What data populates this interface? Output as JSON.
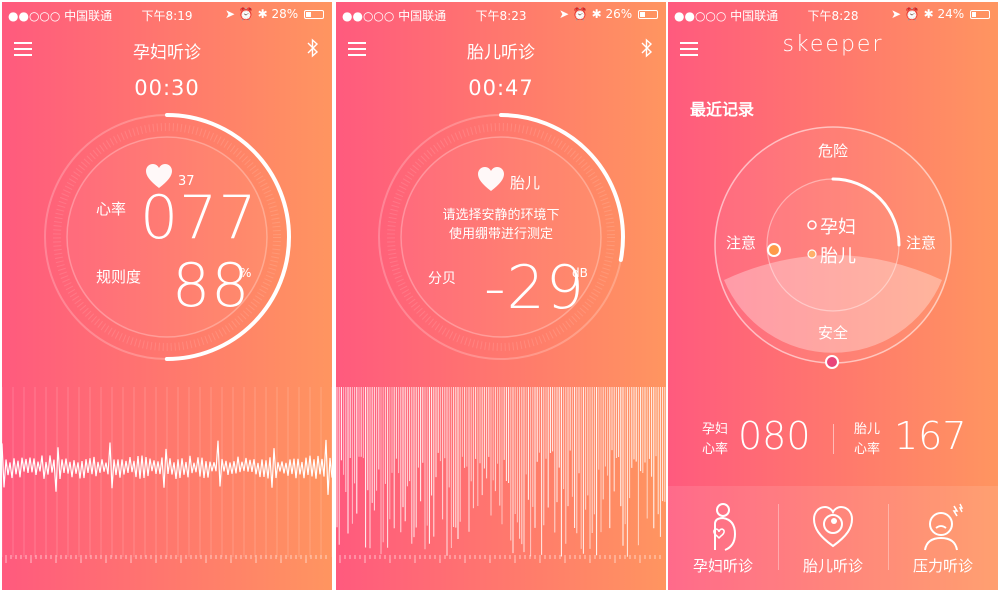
{
  "status_bars": [
    {
      "carrier": "●●○○○ 中国联通",
      "time": "下午8:19",
      "battery": "28%",
      "battery_level": 0.28
    },
    {
      "carrier": "●●○○○ 中国联通",
      "time": "下午8:23",
      "battery": "26%",
      "battery_level": 0.26
    },
    {
      "carrier": "●●○○○ 中国联通",
      "time": "下午8:28",
      "battery": "24%",
      "battery_level": 0.24
    }
  ],
  "maternal_screen": {
    "title": "孕妇听诊",
    "timer": "00:30",
    "heart_badge": "37",
    "heart_rate_label": "心率",
    "heart_rate_value": "077",
    "regularity_label": "规则度",
    "regularity_value": "88",
    "regularity_unit": "%",
    "progress": 0.5
  },
  "fetal_screen": {
    "title": "胎儿听诊",
    "timer": "00:47",
    "heart_label": "胎儿",
    "instruction_line1": "请选择安静的环境下",
    "instruction_line2": "使用绷带进行测定",
    "decibel_label": "分贝",
    "decibel_value": "-29",
    "decibel_unit": "dB",
    "progress": 0.28
  },
  "home_screen": {
    "brand": "skeeper",
    "recent_label": "最近记录",
    "gauge": {
      "danger": "危险",
      "caution_left": "注意",
      "caution_right": "注意",
      "safe": "安全",
      "legend_maternal": "孕妇",
      "legend_fetal": "胎儿"
    },
    "maternal_rate_label_1": "孕妇",
    "maternal_rate_label_2": "心率",
    "maternal_rate_value": "080",
    "fetal_rate_label_1": "胎儿",
    "fetal_rate_label_2": "心率",
    "fetal_rate_value": "167",
    "tabs": [
      {
        "label": "孕妇听诊",
        "icon": "pregnant-woman-icon"
      },
      {
        "label": "胎儿听诊",
        "icon": "fetus-heart-icon"
      },
      {
        "label": "压力听诊",
        "icon": "stress-head-icon"
      }
    ]
  },
  "colors": {
    "gradient_left": "#ff5a7e",
    "gradient_right": "#ff9560",
    "marker_maternal": "#ff9a4a",
    "marker_fetal": "#e8457a"
  }
}
